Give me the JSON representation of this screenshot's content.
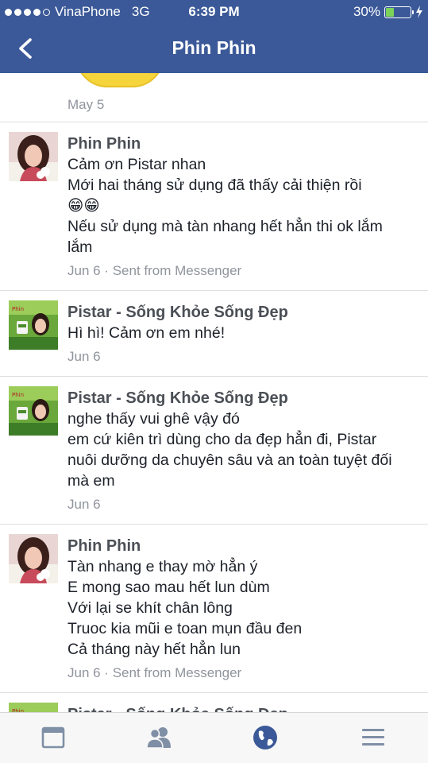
{
  "status_bar": {
    "carrier": "VinaPhone",
    "network": "3G",
    "time": "6:39 PM",
    "battery": "30%",
    "battery_level": 0.3
  },
  "header": {
    "title": "Phin Phin"
  },
  "top_partial": {
    "date": "May 5"
  },
  "messages": [
    {
      "sender": "Phin Phin",
      "lines": [
        "Cảm ơn Pistar nhan",
        "Mới hai tháng sử dụng đã thấy cải thiện rồi",
        "😁😁",
        "Nếu sử dụng mà tàn nhang hết hẳn thi ok lắm",
        "lắm"
      ],
      "meta": "Jun 6 · Sent from Messenger"
    },
    {
      "sender": "Pistar - Sống Khỏe Sống Đẹp",
      "lines": [
        "Hì hì! Cảm ơn em nhé!"
      ],
      "meta": "Jun 6"
    },
    {
      "sender": "Pistar - Sống Khỏe Sống Đẹp",
      "lines": [
        "nghe thấy vui ghê vậy đó",
        "em cứ kiên trì dùng cho da đẹp hẳn đi, Pistar",
        "nuôi dưỡng da chuyên sâu và an toàn tuyệt đối",
        "mà em"
      ],
      "meta": "Jun 6"
    },
    {
      "sender": "Phin Phin",
      "lines": [
        "Tàn nhang e thay mờ hẳn ý",
        "E mong sao mau hết lun dùm",
        "Với lại se khít chân lông",
        "Truoc kia mũi e toan mụn đầu đen",
        "Cả tháng này hết hẳn lun"
      ],
      "meta": "Jun 6 · Sent from Messenger"
    },
    {
      "sender": "Pistar - Sống Khỏe Sống Đẹp",
      "lines": [],
      "meta": ""
    }
  ],
  "tab_bar": {
    "icons": [
      "news-feed-icon",
      "friends-icon",
      "globe-icon",
      "menu-icon"
    ],
    "active_color": "#3b5998",
    "inactive_color": "#7f8fa6"
  },
  "colors": {
    "brand": "#3b5998",
    "sender": "#4b4f56",
    "meta": "#90949c"
  }
}
